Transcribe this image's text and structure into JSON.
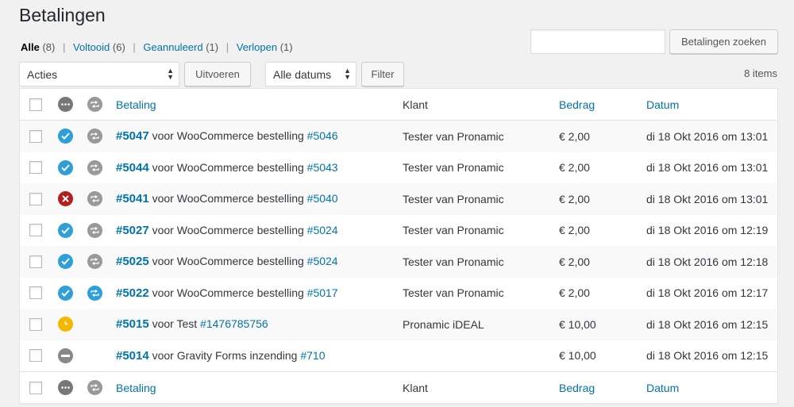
{
  "page": {
    "title": "Betalingen"
  },
  "views": [
    {
      "label": "Alle",
      "count": "(8)"
    },
    {
      "label": "Voltooid",
      "count": "(6)"
    },
    {
      "label": "Geannuleerd",
      "count": "(1)"
    },
    {
      "label": "Verlopen",
      "count": "(1)"
    }
  ],
  "search": {
    "value": "",
    "button": "Betalingen zoeken"
  },
  "bulk": {
    "selected": "Acties",
    "apply": "Uitvoeren"
  },
  "dates": {
    "selected": "Alle datums",
    "filter": "Filter"
  },
  "items_count": "8 items",
  "columns": {
    "betaling": "Betaling",
    "klant": "Klant",
    "bedrag": "Bedrag",
    "datum": "Datum"
  },
  "rows": [
    {
      "id": "#5047",
      "text": " voor WooCommerce bestelling ",
      "ref": "#5046",
      "klant": "Tester van Pronamic",
      "bedrag": "€ 2,00",
      "datum": "di 18 Okt 2016 om 13:01"
    },
    {
      "id": "#5044",
      "text": " voor WooCommerce bestelling ",
      "ref": "#5043",
      "klant": "Tester van Pronamic",
      "bedrag": "€ 2,00",
      "datum": "di 18 Okt 2016 om 13:01"
    },
    {
      "id": "#5041",
      "text": " voor WooCommerce bestelling ",
      "ref": "#5040",
      "klant": "Tester van Pronamic",
      "bedrag": "€ 2,00",
      "datum": "di 18 Okt 2016 om 13:01"
    },
    {
      "id": "#5027",
      "text": " voor WooCommerce bestelling ",
      "ref": "#5024",
      "klant": "Tester van Pronamic",
      "bedrag": "€ 2,00",
      "datum": "di 18 Okt 2016 om 12:19"
    },
    {
      "id": "#5025",
      "text": " voor WooCommerce bestelling ",
      "ref": "#5024",
      "klant": "Tester van Pronamic",
      "bedrag": "€ 2,00",
      "datum": "di 18 Okt 2016 om 12:18"
    },
    {
      "id": "#5022",
      "text": " voor WooCommerce bestelling ",
      "ref": "#5017",
      "klant": "Tester van Pronamic",
      "bedrag": "€ 2,00",
      "datum": "di 18 Okt 2016 om 12:17"
    },
    {
      "id": "#5015",
      "text": " voor Test ",
      "ref": "#1476785756",
      "klant": "Pronamic iDEAL",
      "bedrag": "€ 10,00",
      "datum": "di 18 Okt 2016 om 12:15"
    },
    {
      "id": "#5014",
      "text": " voor Gravity Forms inzending ",
      "ref": "#710",
      "klant": "",
      "bedrag": "€ 10,00",
      "datum": "di 18 Okt 2016 om 12:15"
    }
  ],
  "colors": {
    "link": "#0073aa",
    "success": "#2e9fd9",
    "cancelled": "#b21f1f",
    "open": "#f5b800",
    "neutral": "#888888",
    "recurring_active": "#2e9fd9",
    "recurring_inactive": "#999999"
  },
  "icons": {
    "status_header": "more-dots-icon",
    "recurring": "repeat-icon",
    "success": "check-circle-icon",
    "cancelled": "x-circle-icon",
    "open": "clock-icon",
    "expired": "minus-circle-icon"
  }
}
